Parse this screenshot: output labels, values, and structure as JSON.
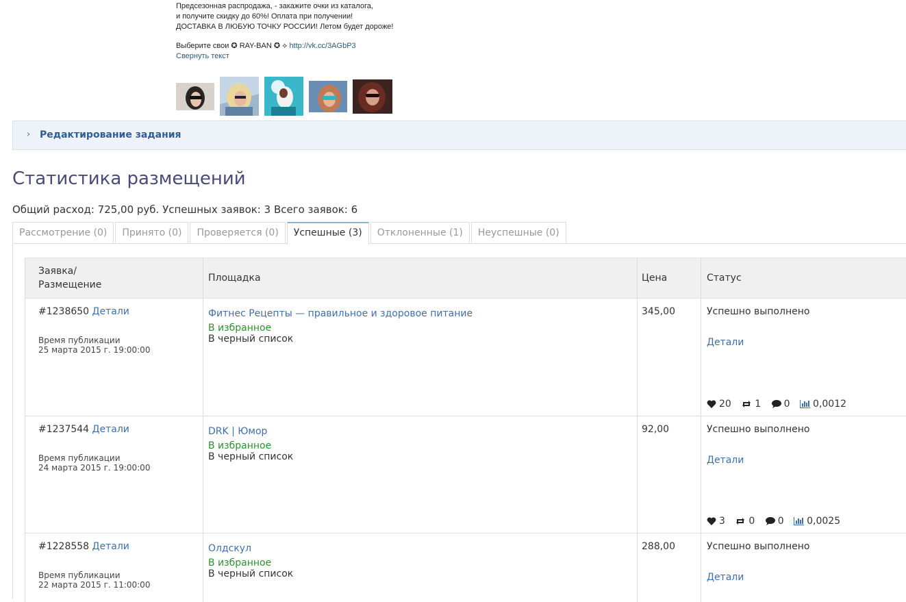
{
  "post": {
    "lines": [
      "Предсезонная распродажа, - закажите очки из каталога,",
      "и получите скидку до 60%! Оплата при получении!",
      "ДОСТАВКА В ЛЮБУЮ ТОЧКУ РОССИИ! Летом будет дороже!"
    ],
    "choose_text": "Выберите свои ✪ RAY-BAN ✪ ⟡",
    "link": "http://vk.cc/3AGbP3",
    "collapse": "Свернуть текст"
  },
  "edit_panel": {
    "label": "Редактирование задания"
  },
  "page_title": "Статистика размещений",
  "summary": "Общий расход: 725,00 руб. Успешных заявок: 3 Всего заявок: 6",
  "tabs": [
    {
      "label": "Рассмотрение (0)"
    },
    {
      "label": "Принято (0)"
    },
    {
      "label": "Проверяется (0)"
    },
    {
      "label": "Успешные (3)"
    },
    {
      "label": "Отклоненные (1)"
    },
    {
      "label": "Неуспешные (0)"
    }
  ],
  "table": {
    "headers": {
      "order_line1": "Заявка/",
      "order_line2": "Размещение",
      "site": "Площадка",
      "price": "Цена",
      "status": "Статус"
    },
    "rows": [
      {
        "order_id": "#1238650",
        "details": "Детали",
        "pub_label": "Время публикации",
        "pub_date": "25 марта 2015 г. 19:00:00",
        "site": "Фитнес Рецепты — правильное и здоровое питание",
        "favorite": "В избранное",
        "blacklist": "В черный список",
        "price": "345,00",
        "status": "Успешно выполнено",
        "status_details": "Детали",
        "likes": "20",
        "reposts": "1",
        "comments": "0",
        "ratio": "0,0012"
      },
      {
        "order_id": "#1237544",
        "details": "Детали",
        "pub_label": "Время публикации",
        "pub_date": "24 марта 2015 г. 19:00:00",
        "site": "DRK | Юмор",
        "favorite": "В избранное",
        "blacklist": "В черный список",
        "price": "92,00",
        "status": "Успешно выполнено",
        "status_details": "Детали",
        "likes": "3",
        "reposts": "0",
        "comments": "0",
        "ratio": "0,0025"
      },
      {
        "order_id": "#1228558",
        "details": "Детали",
        "pub_label": "Время публикации",
        "pub_date": "22 марта 2015 г. 11:00:00",
        "site": "Олдскул",
        "favorite": "В избранное",
        "blacklist": "В черный список",
        "price": "288,00",
        "status": "Успешно выполнено",
        "status_details": "Детали"
      }
    ]
  },
  "colors": {
    "link": "#3f6fab",
    "favorite": "#2f8f2f",
    "title": "#4a4a7a"
  },
  "icons": [
    "heart-icon",
    "repost-icon",
    "comment-icon",
    "chart-icon",
    "chevron-right-icon"
  ]
}
